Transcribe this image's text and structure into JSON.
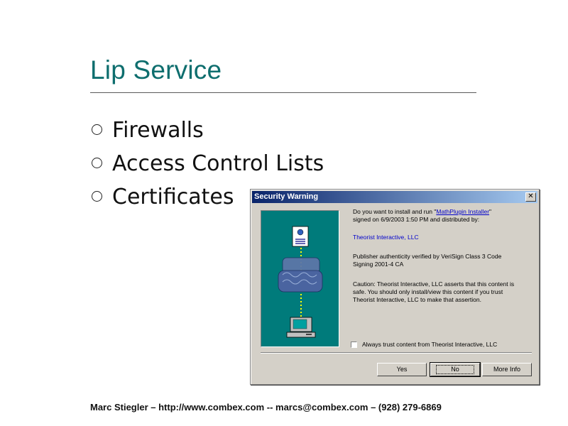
{
  "slide": {
    "title": "Lip Service",
    "bullets": [
      "Firewalls",
      "Access Control Lists",
      "Certificates"
    ],
    "footer": "Marc Stiegler – http://www.combex.com -- marcs@combex.com – (928) 279-6869"
  },
  "dialog": {
    "title": "Security Warning",
    "close_glyph": "✕",
    "line1_prefix": "Do you want to install and run \"",
    "line1_link": "MathPlugin Installer",
    "line1_suffix": "\"",
    "line2": "signed on 6/9/2003 1:50 PM and distributed by:",
    "publisher": "Theorist Interactive, LLC",
    "auth1": "Publisher authenticity verified by VeriSign Class 3 Code",
    "auth2": "Signing 2001-4 CA",
    "caution1": "Caution: Theorist Interactive, LLC asserts that this content is",
    "caution2": "safe. You should only install/view this content if you trust",
    "caution3": "Theorist Interactive, LLC to make that assertion.",
    "checkbox_label": "Always trust content from Theorist Interactive, LLC",
    "buttons": {
      "yes": "Yes",
      "no": "No",
      "more": "More Info"
    }
  }
}
